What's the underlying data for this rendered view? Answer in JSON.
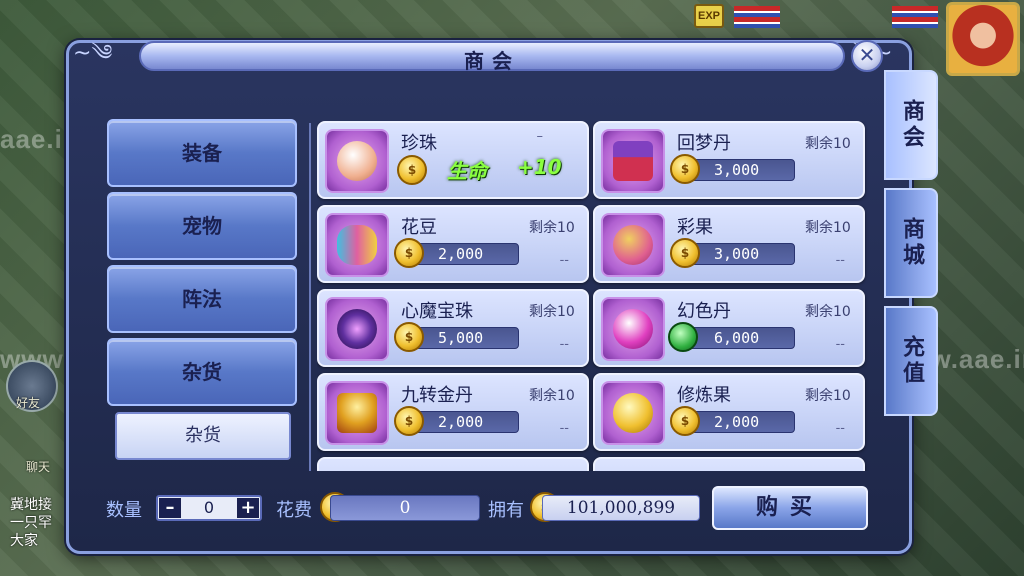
{
  "panel": {
    "title": "商会"
  },
  "hud": {
    "exp_label": "EXP",
    "watermark": "aae.ink",
    "watermark2": "www.aae.ink"
  },
  "side": {
    "friend_label": "好友",
    "chat_label": "聊天",
    "chat_lines": [
      "冀地接",
      "一只罕",
      "大家"
    ]
  },
  "categories": [
    {
      "label": "装备"
    },
    {
      "label": "宠物"
    },
    {
      "label": "阵法"
    },
    {
      "label": "杂货"
    }
  ],
  "subcategory": {
    "label": "杂货"
  },
  "items": [
    {
      "name": "珍珠",
      "price": "",
      "remain": "",
      "dash_top": "–",
      "dash": "",
      "icon": "pearl-icon",
      "color": "#f0b090",
      "buff": "生命",
      "buff_value": "+10"
    },
    {
      "name": "回梦丹",
      "price": "3,000",
      "remain": "剩余10",
      "dash": "",
      "icon": "treasure-box-icon",
      "color": "#d03050"
    },
    {
      "name": "花豆",
      "price": "2,000",
      "remain": "剩余10",
      "dash": "--",
      "icon": "bean-icon",
      "color": "#40c0e0"
    },
    {
      "name": "彩果",
      "price": "3,000",
      "remain": "剩余10",
      "dash": "--",
      "icon": "fruit-icon",
      "color": "#e06090"
    },
    {
      "name": "心魔宝珠",
      "price": "5,000",
      "remain": "剩余10",
      "dash": "--",
      "icon": "dark-orb-icon",
      "color": "#6030a0"
    },
    {
      "name": "幻色丹",
      "price": "6,000",
      "remain": "剩余10",
      "dash": "--",
      "icon": "pink-orb-icon",
      "color": "#e040c0",
      "currency": "jade"
    },
    {
      "name": "九转金丹",
      "price": "2,000",
      "remain": "剩余10",
      "dash": "--",
      "icon": "golden-pill-icon",
      "color": "#e0a020"
    },
    {
      "name": "修炼果",
      "price": "2,000",
      "remain": "剩余10",
      "dash": "--",
      "icon": "gold-orb-icon",
      "color": "#f0c030"
    }
  ],
  "tabs": [
    {
      "label": "商会",
      "active": true
    },
    {
      "label": "商城",
      "active": false
    },
    {
      "label": "充值",
      "active": false
    }
  ],
  "bottom": {
    "qty_label": "数量",
    "qty_minus": "–",
    "qty_value": "0",
    "qty_plus": "+",
    "cost_label": "花费",
    "cost_value": "0",
    "own_label": "拥有",
    "own_value": "101,000,899",
    "buy_label": "购买"
  }
}
